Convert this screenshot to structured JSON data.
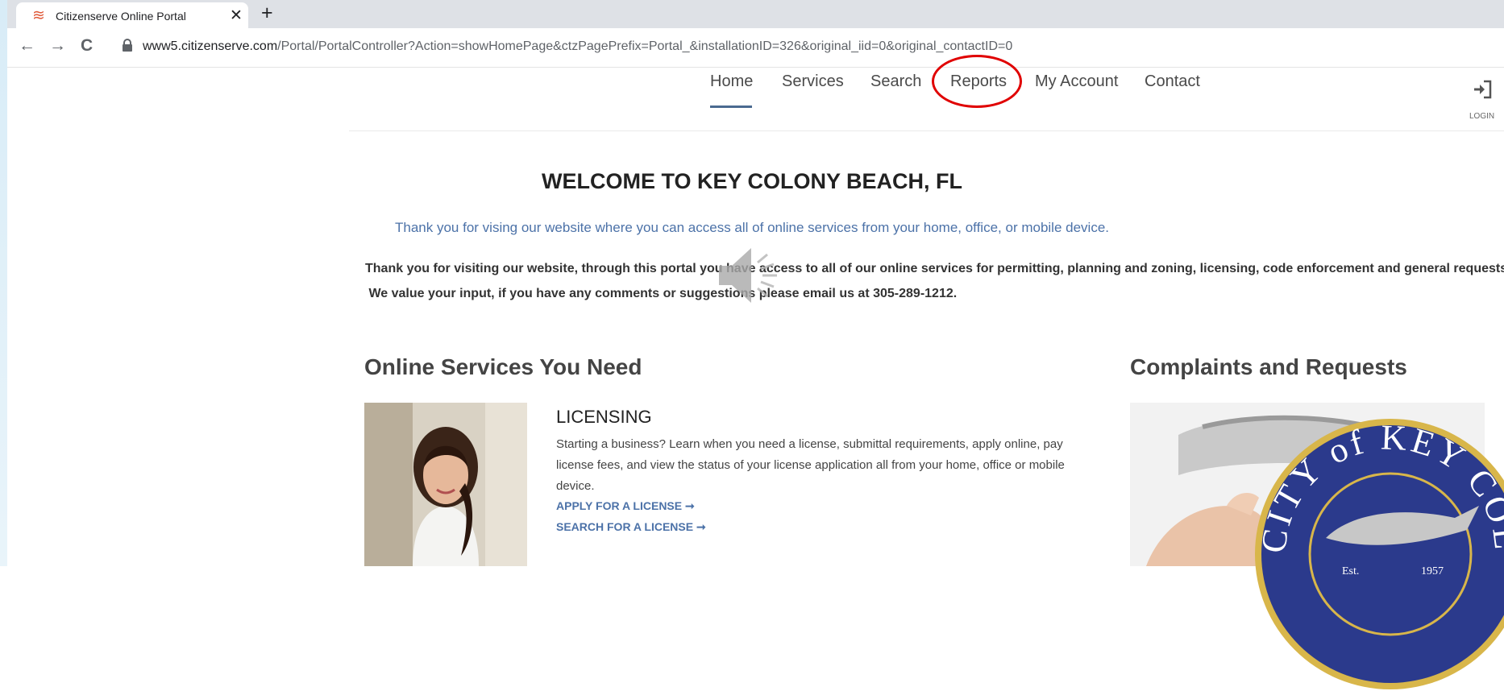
{
  "browser": {
    "tab_title": "Citizenserve Online Portal",
    "tab_close": "✕",
    "new_tab": "+",
    "url_host": "www5.citizenserve.com",
    "url_path": "/Portal/PortalController?Action=showHomePage&ctzPagePrefix=Portal_&installationID=326&original_iid=0&original_contactID=0",
    "back": "←",
    "forward": "→",
    "reload": "C"
  },
  "nav": {
    "items": [
      "Home",
      "Services",
      "Search",
      "Reports",
      "My Account",
      "Contact"
    ],
    "login_label": "LOGIN"
  },
  "welcome": {
    "title": "WELCOME TO KEY COLONY BEACH, FL",
    "subtitle": "Thank you for vising our website where you can access all of online services from your home, office, or mobile device.",
    "line1": "Thank you for visiting our website, through this portal you have access to all of our online services for permitting, planning and zoning, licensing, code enforcement and general requests.",
    "line2": " We value your input, if you have any comments or suggestions please email us at 305-289-1212."
  },
  "services": {
    "heading": "Online Services You Need",
    "licensing": {
      "title": "LICENSING",
      "description": "Starting a business? Learn when you need a license, submittal requirements, apply online, pay license fees, and view the status of your license application all from your home, office or mobile device.",
      "link_apply": "APPLY FOR A LICENSE ➞",
      "link_search": "SEARCH FOR A LICENSE ➞"
    }
  },
  "complaints": {
    "heading": "Complaints and Requests"
  },
  "seal": {
    "text": "CITY of KEY COLONY BEACH",
    "est": "Est.",
    "year": "1957"
  },
  "colors": {
    "accent_blue": "#4c72a8",
    "highlight_red": "#e00000",
    "seal_blue": "#2b3a8c",
    "seal_gold": "#d8b64a"
  }
}
